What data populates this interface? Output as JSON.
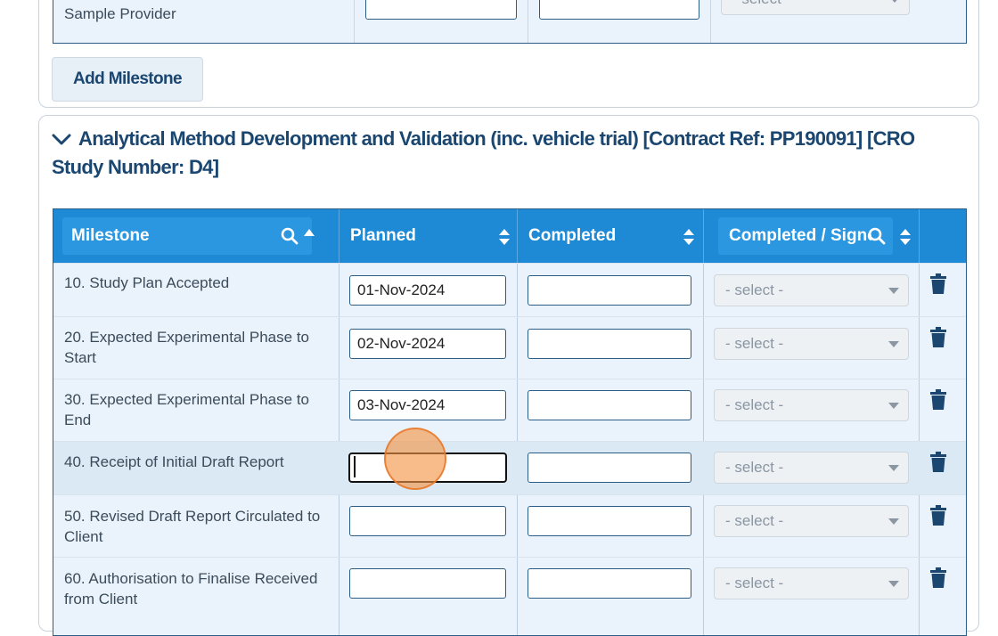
{
  "previous_section": {
    "last_row_text": "All Test Item information received from Sample Provider",
    "select_placeholder": "- select -",
    "add_milestone_label": "Add Milestone"
  },
  "section": {
    "title": "Analytical Method Development and Validation (inc. vehicle trial) [Contract Ref: PP190091] [CRO Study Number: D4]"
  },
  "table": {
    "headers": {
      "milestone": "Milestone",
      "planned": "Planned",
      "completed": "Completed",
      "signed": "Completed / Signed"
    },
    "rows": [
      {
        "milestone": "10. Study Plan Accepted",
        "planned": "01-Nov-2024",
        "completed": "",
        "signed": "- select -"
      },
      {
        "milestone": "20. Expected Experimental Phase to Start",
        "planned": "02-Nov-2024",
        "completed": "",
        "signed": "- select -"
      },
      {
        "milestone": "30. Expected Experimental Phase to End",
        "planned": "03-Nov-2024",
        "completed": "",
        "signed": "- select -"
      },
      {
        "milestone": "40. Receipt of Initial Draft Report",
        "planned": "",
        "completed": "",
        "signed": "- select -"
      },
      {
        "milestone": "50. Revised Draft Report Circulated to Client",
        "planned": "",
        "completed": "",
        "signed": "- select -"
      },
      {
        "milestone": "60. Authorisation to Finalise Received from Client",
        "planned": "",
        "completed": "",
        "signed": "- select -"
      }
    ]
  },
  "colors": {
    "header_bg": "#1e8ad6",
    "title_color": "#1a4670",
    "row_bg": "#eaf3fb",
    "trash_color": "#1a4670"
  }
}
